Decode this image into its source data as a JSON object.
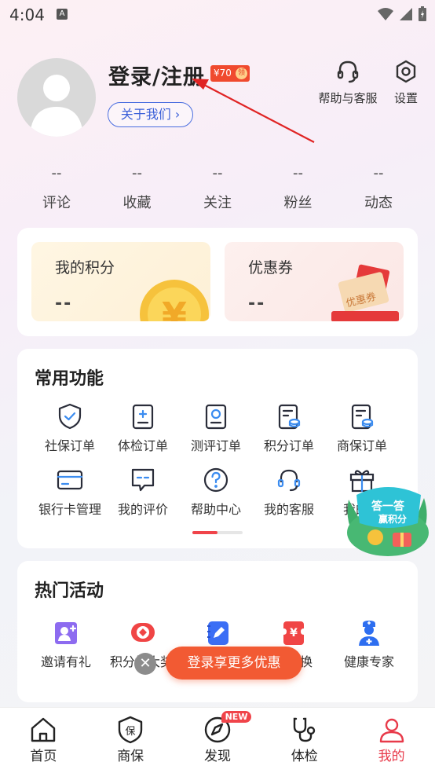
{
  "status": {
    "time": "4:04",
    "notif_icon": "A"
  },
  "profile": {
    "login_title": "登录/注册",
    "coupon_amount": "¥70",
    "coupon_claim": "领",
    "about_label": "关于我们",
    "about_chevron": "›"
  },
  "top_actions": [
    {
      "label": "帮助与客服",
      "icon": "headset-icon"
    },
    {
      "label": "设置",
      "icon": "gear-icon"
    }
  ],
  "stats": [
    {
      "value": "--",
      "label": "评论"
    },
    {
      "value": "--",
      "label": "收藏"
    },
    {
      "value": "--",
      "label": "关注"
    },
    {
      "value": "--",
      "label": "粉丝"
    },
    {
      "value": "--",
      "label": "动态"
    }
  ],
  "points": {
    "my_points": {
      "title": "我的积分",
      "value": "--"
    },
    "coupons": {
      "title": "优惠券",
      "value": "--"
    },
    "coin_symbol": "¥",
    "coupon_art_text": "优惠券"
  },
  "common": {
    "title": "常用功能",
    "items": [
      {
        "label": "社保订单",
        "icon": "shield-check-icon"
      },
      {
        "label": "体检订单",
        "icon": "clipboard-plus-icon"
      },
      {
        "label": "测评订单",
        "icon": "assessment-doc-icon"
      },
      {
        "label": "积分订单",
        "icon": "points-doc-icon"
      },
      {
        "label": "商保订单",
        "icon": "insurance-doc-icon"
      },
      {
        "label": "银行卡管理",
        "icon": "bank-card-icon"
      },
      {
        "label": "我的评价",
        "icon": "comment-icon"
      },
      {
        "label": "帮助中心",
        "icon": "help-circle-icon"
      },
      {
        "label": "我的客服",
        "icon": "headset-icon"
      },
      {
        "label": "我的奖",
        "icon": "gift-icon"
      }
    ]
  },
  "floating_badge": {
    "line1": "答一答",
    "line2": "赢积分"
  },
  "hot": {
    "title": "热门活动",
    "items": [
      {
        "label": "邀请有礼",
        "icon": "invite-icon"
      },
      {
        "label": "积分抽大奖",
        "icon": "lottery-icon"
      },
      {
        "label": "",
        "icon": "edit-note-icon"
      },
      {
        "label": "兑换",
        "icon": "yuan-exchange-icon"
      },
      {
        "label": "健康专家",
        "icon": "doctor-icon"
      }
    ]
  },
  "promo": {
    "label": "登录享更多优惠",
    "close": "✕"
  },
  "tabbar": [
    {
      "label": "首页",
      "icon": "home-icon"
    },
    {
      "label": "商保",
      "icon": "insurance-shield-icon",
      "icon_text": "保"
    },
    {
      "label": "发现",
      "icon": "compass-icon",
      "badge": "NEW"
    },
    {
      "label": "体检",
      "icon": "stethoscope-icon"
    },
    {
      "label": "我的",
      "icon": "user-icon",
      "active": true
    }
  ],
  "colors": {
    "accent": "#e83a4a",
    "promo": "#f25a33",
    "link": "#3a5fd8"
  }
}
